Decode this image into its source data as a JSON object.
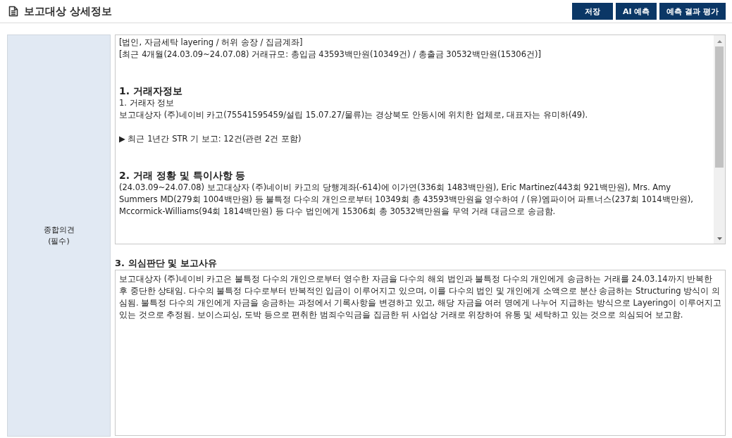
{
  "header": {
    "title": "보고대상 상세정보",
    "buttons": [
      "저장",
      "AI 예측",
      "예측 결과 평가"
    ]
  },
  "field_label": [
    "종합의견",
    "(필수)"
  ],
  "opinion_box": {
    "blocks": [
      {
        "kind": "text",
        "text": "[법인, 자금세탁 layering / 허위 송장 / 집금계좌]"
      },
      {
        "kind": "text",
        "text": "[최근 4개월(24.03.09~24.07.08) 거래규모: 총입금 43593백만원(10349건) / 총출금 30532백만원(15306건)]"
      },
      {
        "kind": "heading",
        "text": "1. 거래자정보"
      },
      {
        "kind": "text",
        "text": "1. 거래자 정보"
      },
      {
        "kind": "text",
        "text": "보고대상자 (주)네이비 카고(75541595459/설립 15.07.27/물류)는 경상북도 안동시에 위치한 업체로, 대표자는 유미하(49)."
      },
      {
        "kind": "note",
        "text": "▶ 최근 1년간 STR 기 보고: 12건(관련 2건 포함)"
      },
      {
        "kind": "heading",
        "text": "2. 거래 정황 및 특이사항 등"
      },
      {
        "kind": "text",
        "text": "(24.03.09~24.07.08) 보고대상자 (주)네이비 카고의 당행계좌(-614)에 이가연(336회 1483백만원), Eric Martinez(443회 921백만원), Mrs. Amy Summers MD(279회 1004백만원) 등 불특정 다수의 개인으로부터 10349회 총 43593백만원을 영수하여 / (유)엠파이어 파트너스(237회 1014백만원), Mccormick-Williams(94회 1814백만원) 등 다수 법인에게 15306회 총 30532백만원을 무역 거래 대금으로 송금함."
      }
    ]
  },
  "reason": {
    "heading": "3. 의심판단 및 보고사유",
    "text": "보고대상자 (주)네이비 카고은 불특정 다수의 개인으로부터 영수한 자금을 다수의 해외 법인과 불특정 다수의 개인에게 송금하는 거래를 24.03.14까지 반복한 후 중단한 상태임. 다수의 불특정 다수로부터 반복적인 입금이 이루어지고 있으며, 이를 다수의 법인 및 개인에게 소액으로 분산 송금하는 Structuring 방식이 의심됨. 불특정 다수의 개인에게 자금을 송금하는 과정에서 기록사항을 변경하고 있고, 해당 자금을 여러 명에게 나누어 지급하는 방식으로 Layering이 이루어지고 있는 것으로 추정됨. 보이스피싱, 도박 등으로 편취한 범죄수익금을 집금한 뒤 사업상 거래로 위장하여 유통 및 세탁하고 있는 것으로 의심되어 보고함."
  }
}
